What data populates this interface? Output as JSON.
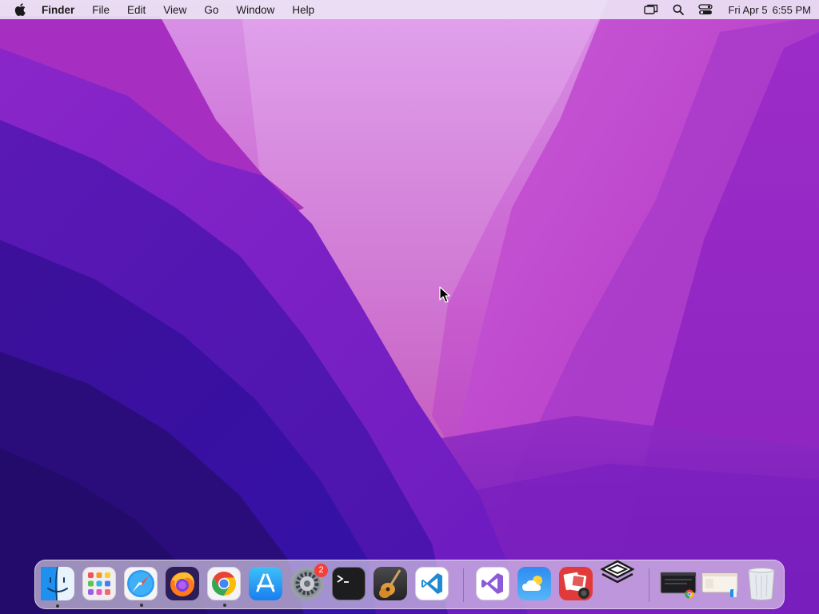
{
  "menubar": {
    "app_name": "Finder",
    "menus": [
      "File",
      "Edit",
      "View",
      "Go",
      "Window",
      "Help"
    ],
    "status_icons": [
      "screen-mirroring-icon",
      "spotlight-search-icon",
      "control-center-icon"
    ],
    "clock": {
      "date": "Fri Apr 5",
      "time": "6:55 PM"
    }
  },
  "dock": {
    "apps": [
      {
        "name": "Finder",
        "icon": "finder-icon",
        "running": true
      },
      {
        "name": "Launchpad",
        "icon": "launchpad-icon",
        "running": false
      },
      {
        "name": "Safari",
        "icon": "safari-icon",
        "running": true
      },
      {
        "name": "Firefox",
        "icon": "firefox-icon",
        "running": false
      },
      {
        "name": "Google Chrome",
        "icon": "chrome-icon",
        "running": true
      },
      {
        "name": "App Store",
        "icon": "app-store-icon",
        "running": false
      },
      {
        "name": "System Settings",
        "icon": "system-settings-icon",
        "running": false,
        "badge": "2"
      },
      {
        "name": "Terminal",
        "icon": "terminal-icon",
        "running": false
      },
      {
        "name": "GarageBand",
        "icon": "garageband-icon",
        "running": false
      },
      {
        "name": "Visual Studio Code",
        "icon": "vscode-icon",
        "running": false
      },
      {
        "name": "Visual Studio",
        "icon": "visual-studio-icon",
        "running": false
      },
      {
        "name": "Weather",
        "icon": "weather-icon",
        "running": false
      },
      {
        "name": "Photo Booth",
        "icon": "photo-booth-icon",
        "running": false
      },
      {
        "name": "Layers App",
        "icon": "layers-icon",
        "running": false
      }
    ],
    "recent": [
      {
        "name": "Chrome Window",
        "icon": "chrome-window-thumbnail-icon"
      },
      {
        "name": "Finder Window",
        "icon": "finder-window-thumbnail-icon"
      }
    ],
    "trash": {
      "name": "Trash",
      "icon": "trash-icon"
    }
  },
  "colors": {
    "menubar_bg": "#ece2f4",
    "badge": "#f3403a",
    "wallpaper_deep": "#2a0d7a",
    "wallpaper_pink": "#c84fd0"
  }
}
